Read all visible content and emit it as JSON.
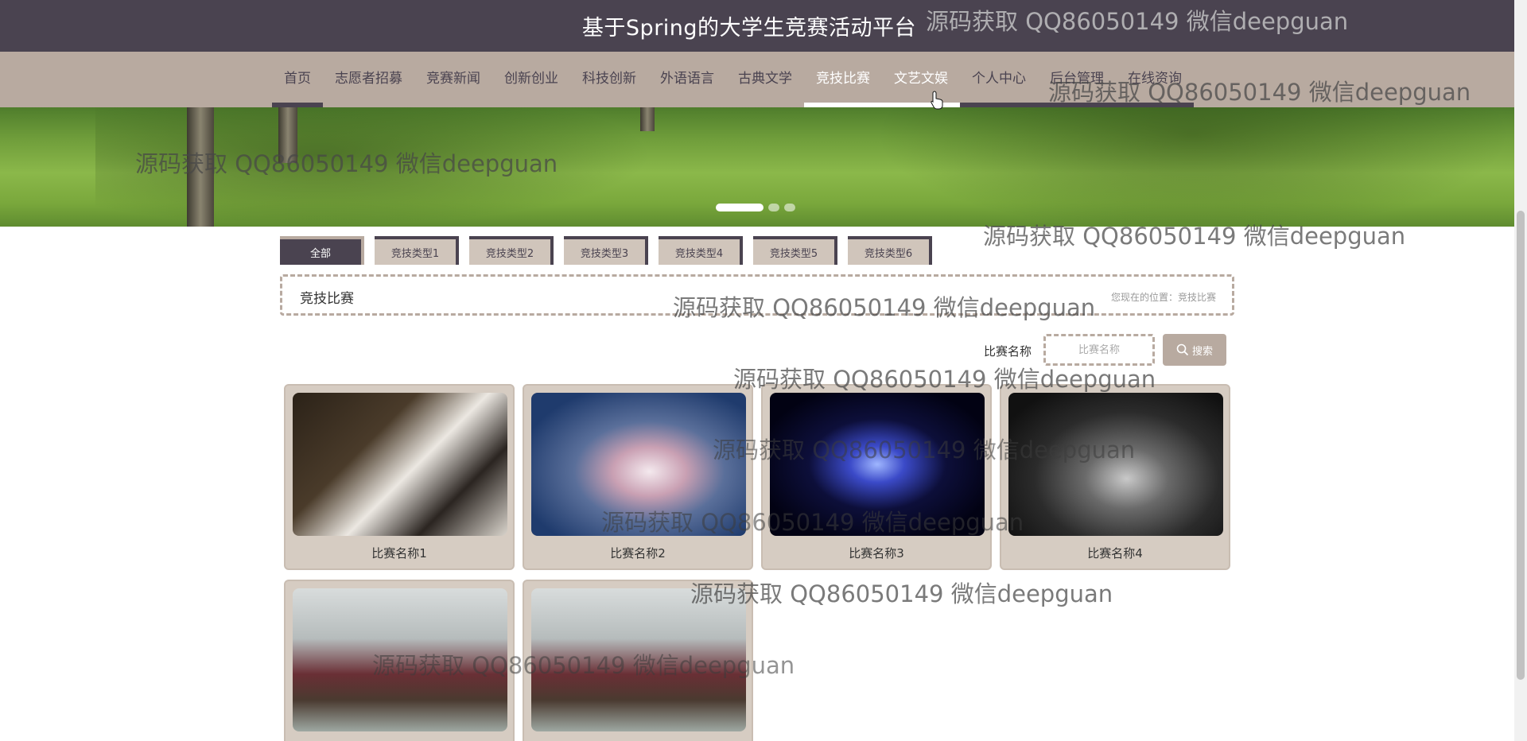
{
  "header": {
    "title": "基于Spring的大学生竞赛活动平台"
  },
  "nav": {
    "items": [
      {
        "label": "首页"
      },
      {
        "label": "志愿者招募"
      },
      {
        "label": "竞赛新闻"
      },
      {
        "label": "创新创业"
      },
      {
        "label": "科技创新"
      },
      {
        "label": "外语语言"
      },
      {
        "label": "古典文学"
      },
      {
        "label": "竞技比赛"
      },
      {
        "label": "文艺文娱"
      },
      {
        "label": "个人中心"
      },
      {
        "label": "后台管理"
      },
      {
        "label": "在线资询"
      }
    ],
    "active_index": 7
  },
  "tabs": [
    {
      "label": "全部"
    },
    {
      "label": "竞技类型1"
    },
    {
      "label": "竞技类型2"
    },
    {
      "label": "竞技类型3"
    },
    {
      "label": "竞技类型4"
    },
    {
      "label": "竞技类型5"
    },
    {
      "label": "竞技类型6"
    }
  ],
  "breadcrumb": {
    "title": "竞技比赛",
    "position": "您现在的位置：竞技比赛"
  },
  "search": {
    "label": "比赛名称",
    "placeholder": "比赛名称",
    "button_label": "搜索"
  },
  "cards": [
    {
      "name": "比赛名称1"
    },
    {
      "name": "比赛名称2"
    },
    {
      "name": "比赛名称3"
    },
    {
      "name": "比赛名称4"
    },
    {
      "name": ""
    },
    {
      "name": ""
    }
  ],
  "watermark": "源码获取 QQ86050149 微信deepguan",
  "colors": {
    "header_bg": "#4a4350",
    "nav_bg": "#b8aaa0",
    "card_bg": "#d6ccc2",
    "active_text": "#ffffff"
  }
}
